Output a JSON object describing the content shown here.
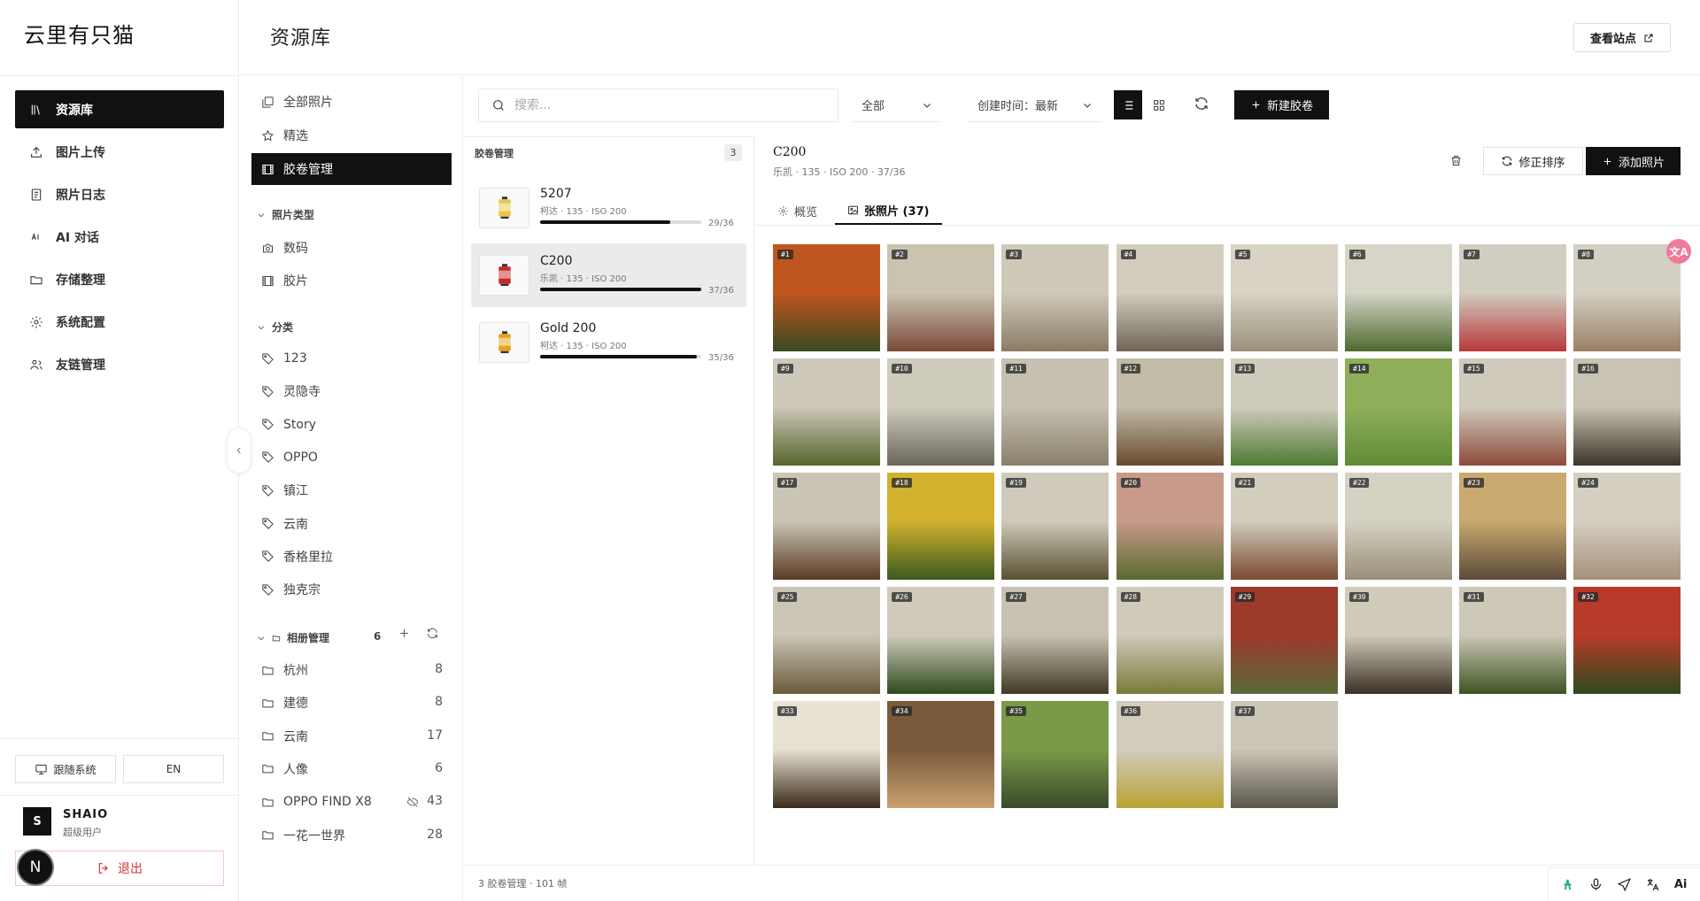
{
  "app": {
    "brand": "云里有只猫"
  },
  "header": {
    "title": "资源库",
    "view_site": "查看站点"
  },
  "sidebar": {
    "items": [
      {
        "label": "资源库",
        "icon": "library-icon",
        "active": true
      },
      {
        "label": "图片上传",
        "icon": "upload-icon"
      },
      {
        "label": "照片日志",
        "icon": "journal-icon"
      },
      {
        "label": "AI 对话",
        "icon": "ai-chat-icon"
      },
      {
        "label": "存储整理",
        "icon": "folder-open-icon"
      },
      {
        "label": "系统配置",
        "icon": "gear-icon"
      },
      {
        "label": "友链管理",
        "icon": "users-icon"
      }
    ],
    "theme_label": "跟随系统",
    "lang_label": "EN",
    "user": {
      "initial": "S",
      "name": "SHAIO",
      "role": "超级用户"
    },
    "logout_label": "退出",
    "n_badge": "N"
  },
  "subnav": {
    "top": [
      {
        "label": "全部照片",
        "icon": "photos-icon"
      },
      {
        "label": "精选",
        "icon": "star-icon"
      },
      {
        "label": "胶卷管理",
        "icon": "film-icon",
        "active": true
      }
    ],
    "type_section": "照片类型",
    "types": [
      {
        "label": "数码",
        "icon": "camera-icon"
      },
      {
        "label": "胶片",
        "icon": "film-icon"
      }
    ],
    "category_section": "分类",
    "categories": [
      "123",
      "灵隐寺",
      "Story",
      "OPPO",
      "镇江",
      "云南",
      "香格里拉",
      "独克宗"
    ],
    "album_section": "相册管理",
    "album_count": "6",
    "albums": [
      {
        "label": "杭州",
        "count": "8"
      },
      {
        "label": "建德",
        "count": "8"
      },
      {
        "label": "云南",
        "count": "17"
      },
      {
        "label": "人像",
        "count": "6"
      },
      {
        "label": "OPPO FIND X8",
        "count": "43",
        "hidden": true
      },
      {
        "label": "一花一世界",
        "count": "28"
      }
    ]
  },
  "toolbar": {
    "search_placeholder": "搜索...",
    "filter_value": "全部",
    "sort_value": "创建时间：最新",
    "new_roll": "新建胶卷"
  },
  "rolls": {
    "title": "胶卷管理",
    "count": "3",
    "items": [
      {
        "name": "5207",
        "meta": "柯达 · 135 · ISO 200",
        "used": 29,
        "total": 36,
        "frames": "29/36",
        "color": "#e7c64a"
      },
      {
        "name": "C200",
        "meta": "乐凯 · 135 · ISO 200",
        "used": 37,
        "total": 36,
        "frames": "37/36",
        "color": "#c8282b",
        "active": true
      },
      {
        "name": "Gold 200",
        "meta": "柯达 · 135 · ISO 200",
        "used": 35,
        "total": 36,
        "frames": "35/36",
        "color": "#e3a21a"
      }
    ]
  },
  "detail": {
    "title": "C200",
    "meta": "乐凯 · 135 · ISO 200 · 37/36",
    "fix_order": "修正排序",
    "add_photo": "添加照片",
    "tab_overview": "概览",
    "tab_photos": "张照片 (37)"
  },
  "photos": [
    {
      "num": "#1",
      "c1": "#c0561f",
      "c2": "#3a4a22"
    },
    {
      "num": "#2",
      "c1": "#c9c3b0",
      "c2": "#7b4a3a"
    },
    {
      "num": "#3",
      "c1": "#cfc9b8",
      "c2": "#8a7c66"
    },
    {
      "num": "#4",
      "c1": "#d2cdbd",
      "c2": "#6f6456"
    },
    {
      "num": "#5",
      "c1": "#d8d3c4",
      "c2": "#9a8f7c"
    },
    {
      "num": "#6",
      "c1": "#d6d5c8",
      "c2": "#4e6a2e"
    },
    {
      "num": "#7",
      "c1": "#d1cdc0",
      "c2": "#b8383a"
    },
    {
      "num": "#8",
      "c1": "#d3cfc2",
      "c2": "#9a8064"
    },
    {
      "num": "#9",
      "c1": "#cdc8b8",
      "c2": "#56642c"
    },
    {
      "num": "#10",
      "c1": "#cfcbbd",
      "c2": "#6b665a"
    },
    {
      "num": "#11",
      "c1": "#c6c0b1",
      "c2": "#8a7f6c"
    },
    {
      "num": "#12",
      "c1": "#c1bba8",
      "c2": "#6a4b2e"
    },
    {
      "num": "#13",
      "c1": "#d0ccbd",
      "c2": "#4e7a32"
    },
    {
      "num": "#14",
      "c1": "#8fae5a",
      "c2": "#5f8c34"
    },
    {
      "num": "#15",
      "c1": "#cfcabc",
      "c2": "#8c4a3a"
    },
    {
      "num": "#16",
      "c1": "#c9c3b3",
      "c2": "#3c3428"
    },
    {
      "num": "#17",
      "c1": "#cac5b6",
      "c2": "#5a3a24"
    },
    {
      "num": "#18",
      "c1": "#d2b22e",
      "c2": "#3c5a1e"
    },
    {
      "num": "#19",
      "c1": "#cfcabb",
      "c2": "#5a5032"
    },
    {
      "num": "#20",
      "c1": "#c79a8a",
      "c2": "#5a6a2e"
    },
    {
      "num": "#21",
      "c1": "#d2cdbd",
      "c2": "#7a4a32"
    },
    {
      "num": "#22",
      "c1": "#d5d1c3",
      "c2": "#9a8e78"
    },
    {
      "num": "#23",
      "c1": "#c9a970",
      "c2": "#5a4a38"
    },
    {
      "num": "#24",
      "c1": "#d4cfc1",
      "c2": "#a6907a"
    },
    {
      "num": "#25",
      "c1": "#cbc6b6",
      "c2": "#6a5a3a"
    },
    {
      "num": "#26",
      "c1": "#d0cbbb",
      "c2": "#2f4a1c"
    },
    {
      "num": "#27",
      "c1": "#c7c2b2",
      "c2": "#3e3a24"
    },
    {
      "num": "#28",
      "c1": "#cfcab9",
      "c2": "#7a7a3a"
    },
    {
      "num": "#29",
      "c1": "#9a3a2a",
      "c2": "#5a6a3a"
    },
    {
      "num": "#30",
      "c1": "#d0cbbb",
      "c2": "#3a3024"
    },
    {
      "num": "#31",
      "c1": "#cdc8b8",
      "c2": "#3e5422"
    },
    {
      "num": "#32",
      "c1": "#b83a2a",
      "c2": "#2e4a1c"
    },
    {
      "num": "#33",
      "c1": "#e8e2d2",
      "c2": "#3a2a1a"
    },
    {
      "num": "#34",
      "c1": "#7a5a3a",
      "c2": "#c9a070"
    },
    {
      "num": "#35",
      "c1": "#7a9a4a",
      "c2": "#3a4a2a"
    },
    {
      "num": "#36",
      "c1": "#d1ccbc",
      "c2": "#b8a232"
    },
    {
      "num": "#37",
      "c1": "#cbc6b7",
      "c2": "#5a564a"
    }
  ],
  "footer": {
    "text": "3 胶卷管理 · 101 帧"
  },
  "translate_badge": "文A",
  "footer_tools": {
    "ai_label": "Ai"
  }
}
